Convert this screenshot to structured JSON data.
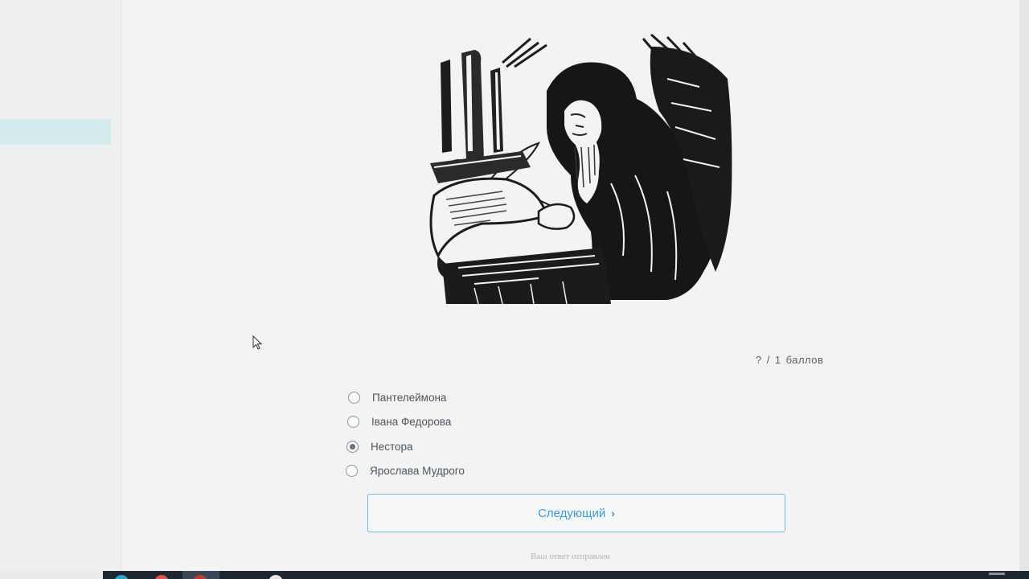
{
  "quiz": {
    "score": {
      "earned": "?",
      "separator": "/",
      "max": "1",
      "unit": "баллов"
    },
    "options": [
      {
        "label": "Пантелеймона",
        "selected": false
      },
      {
        "label": "Івана Федорова",
        "selected": false
      },
      {
        "label": "Нестора",
        "selected": true
      },
      {
        "label": "Ярослава Мудрого",
        "selected": false
      }
    ],
    "next_button": {
      "label": "Следующий",
      "icon": "chevron-right-icon"
    },
    "status_text": "Ваш ответ отправлен"
  },
  "colors": {
    "accent": "#3d9ad8",
    "button_border": "#6db8e6",
    "sidebar_highlight": "#d3ebec",
    "taskbar": "#1d2631"
  }
}
